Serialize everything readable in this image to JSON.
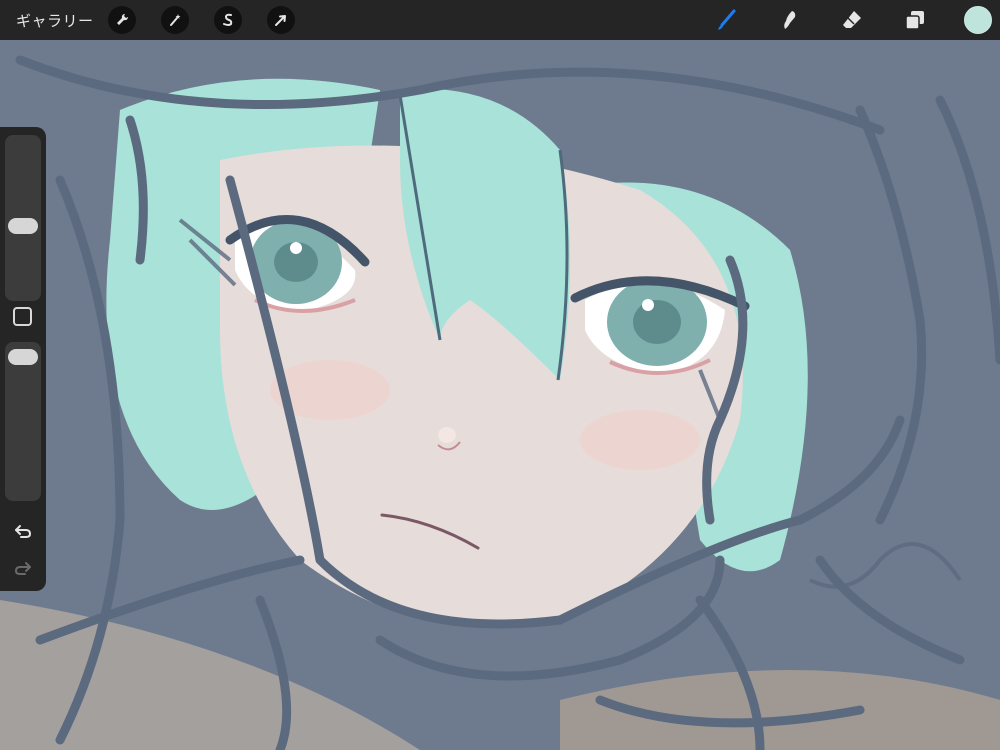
{
  "toolbar": {
    "gallery_label": "ギャラリー",
    "left_tools": [
      {
        "name": "actions",
        "icon": "wrench-icon"
      },
      {
        "name": "adjustments",
        "icon": "magic-wand-icon"
      },
      {
        "name": "selection",
        "icon": "selection-s-icon"
      },
      {
        "name": "transform",
        "icon": "arrow-cursor-icon"
      }
    ],
    "right_tools": [
      {
        "name": "brush",
        "icon": "brush-icon",
        "active": true
      },
      {
        "name": "smudge",
        "icon": "smudge-icon",
        "active": false
      },
      {
        "name": "eraser",
        "icon": "eraser-icon",
        "active": false
      },
      {
        "name": "layers",
        "icon": "layers-icon",
        "active": false
      }
    ],
    "current_color": "#bfe4dc",
    "active_color": "#1e7bf0"
  },
  "sidebar": {
    "brush_size_level": 0.45,
    "opacity_level": 0.95,
    "undo_icon": "undo-icon",
    "redo_icon": "redo-icon",
    "modify_icon": "square-modify-icon"
  }
}
